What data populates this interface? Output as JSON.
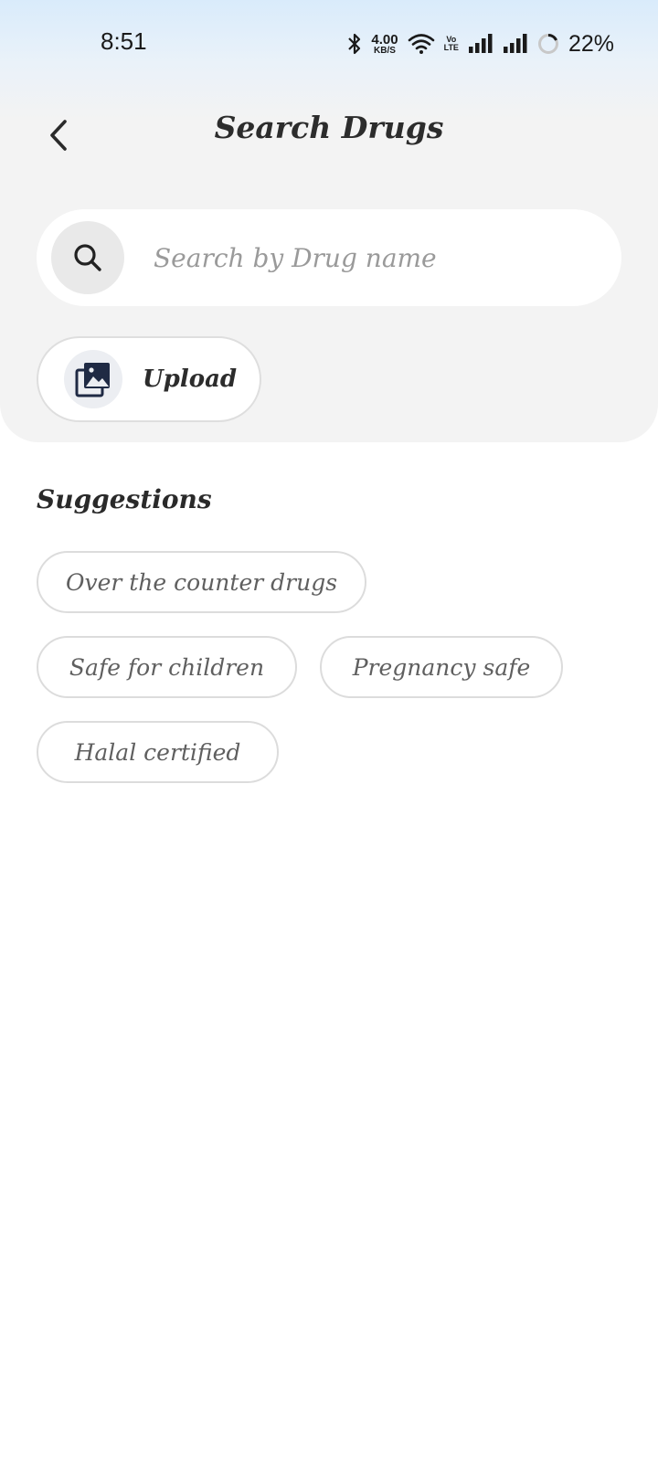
{
  "status_bar": {
    "time": "8:51",
    "net_speed_value": "4.00",
    "net_speed_unit": "KB/S",
    "volte_top": "Vo",
    "volte_bottom": "LTE",
    "battery_percent": "22%",
    "icons": [
      "bluetooth-icon",
      "wifi-icon",
      "signal-icon",
      "signal-icon",
      "battery-ring-icon"
    ]
  },
  "header": {
    "title": "Search Drugs",
    "back_icon": "chevron-left-icon"
  },
  "search": {
    "placeholder": "Search by Drug name",
    "icon": "search-icon"
  },
  "upload": {
    "label": "Upload",
    "icon": "image-gallery-icon"
  },
  "suggestions": {
    "title": "Suggestions",
    "items": [
      "Over the counter drugs",
      "Safe for children",
      "Pregnancy safe",
      "Halal certified"
    ]
  },
  "colors": {
    "panel_bg": "#f3f3f3",
    "status_gradient_top": "#d9ebfb",
    "text_dark": "#2c2c2c",
    "chip_border": "#dcdcdc",
    "chip_text": "#5f5f5f"
  }
}
